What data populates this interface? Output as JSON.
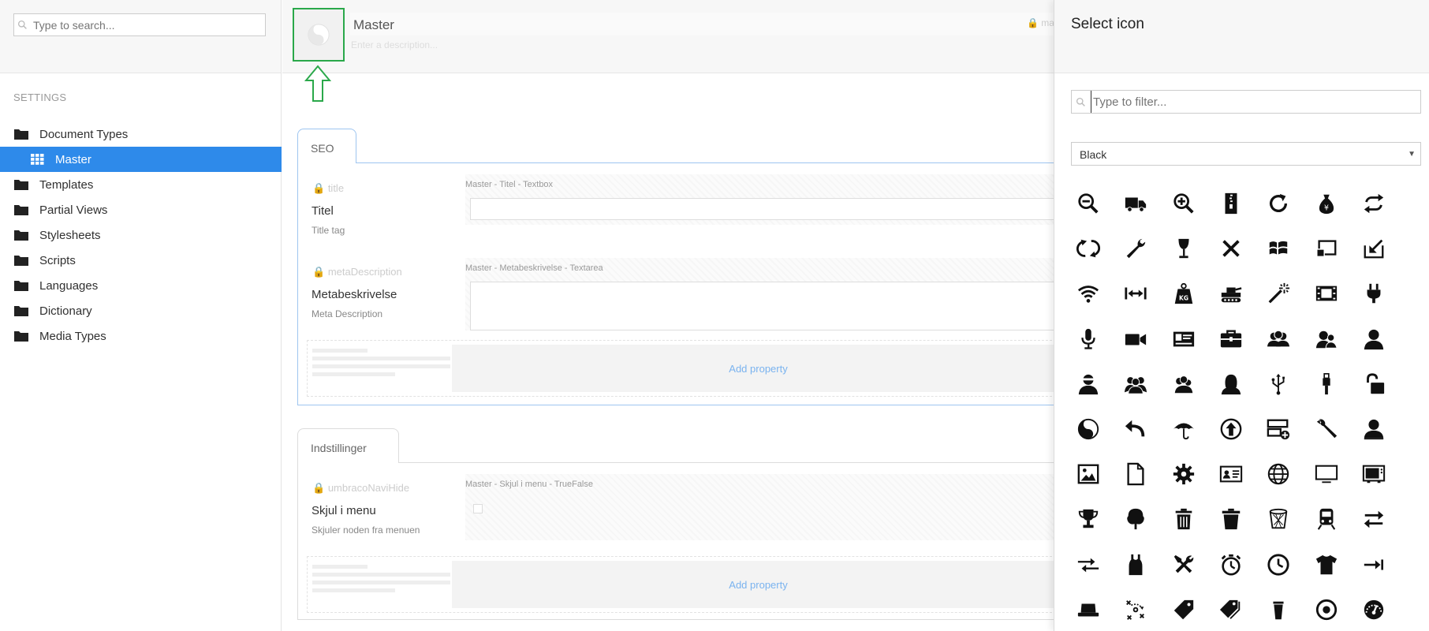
{
  "sidebar": {
    "search_placeholder": "Type to search...",
    "section_heading": "SETTINGS",
    "items": [
      {
        "label": "Document Types",
        "active": false,
        "icon": "folder-icon"
      },
      {
        "label": "Master",
        "active": true,
        "icon": "grid-icon"
      },
      {
        "label": "Templates",
        "active": false,
        "icon": "folder-icon"
      },
      {
        "label": "Partial Views",
        "active": false,
        "icon": "folder-icon"
      },
      {
        "label": "Stylesheets",
        "active": false,
        "icon": "folder-icon"
      },
      {
        "label": "Scripts",
        "active": false,
        "icon": "folder-icon"
      },
      {
        "label": "Languages",
        "active": false,
        "icon": "folder-icon"
      },
      {
        "label": "Dictionary",
        "active": false,
        "icon": "folder-icon"
      },
      {
        "label": "Media Types",
        "active": false,
        "icon": "folder-icon"
      }
    ]
  },
  "editor": {
    "name": "Master",
    "alias_prefix": "ma",
    "description_placeholder": "Enter a description...",
    "groups": [
      {
        "tab": "SEO",
        "properties": [
          {
            "alias": "title",
            "label": "Titel",
            "description": "Title tag",
            "meta": "Master - Titel - Textbox"
          },
          {
            "alias": "metaDescription",
            "label": "Metabeskrivelse",
            "description": "Meta Description",
            "meta": "Master - Metabeskrivelse - Textarea"
          }
        ],
        "add_property": "Add property"
      },
      {
        "tab": "Indstillinger",
        "properties": [
          {
            "alias": "umbracoNaviHide",
            "label": "Skjul i menu",
            "description": "Skjuler noden fra menuen",
            "meta": "Master - Skjul i menu - TrueFalse"
          }
        ],
        "add_property": "Add property"
      }
    ]
  },
  "panel": {
    "title": "Select icon",
    "filter_placeholder": "Type to filter...",
    "color_selected": "Black",
    "icons": [
      "zoom-out-icon",
      "truck-icon",
      "zoom-in-icon",
      "zip-icon",
      "refresh-icon",
      "yen-bag-icon",
      "sync-icon",
      "sync-vertical-icon",
      "wrench-icon",
      "wine-glass-icon",
      "close-icon",
      "windows-icon",
      "cast-icon",
      "download-corner-icon",
      "wifi-icon",
      "width-icon",
      "weight-icon",
      "tank-icon",
      "magic-wand-icon",
      "film-icon",
      "plug-icon",
      "microphone-icon",
      "video-icon",
      "id-card-icon",
      "toolbox-icon",
      "users-icon",
      "users-alt-icon",
      "user-icon",
      "user-glasses-icon",
      "user-group-icon",
      "users-three-icon",
      "user-female-icon",
      "usb-icon",
      "usb-plug-icon",
      "unlock-icon",
      "yin-yang-icon",
      "undo-icon",
      "umbrella-icon",
      "upload-circle-icon",
      "server-add-icon",
      "tool-icon",
      "user-badge-icon",
      "picture-icon",
      "document-icon",
      "gear-icon",
      "address-card-icon",
      "globe-icon",
      "monitor-icon",
      "tv-icon",
      "trophy-icon",
      "tree-icon",
      "trash-icon",
      "trash-alt-icon",
      "bin-icon",
      "train-icon",
      "transfer-icon",
      "exchange-icon",
      "tank-top-icon",
      "tools-icon",
      "stopwatch-icon",
      "clock-icon",
      "tshirt-icon",
      "tab-key-icon",
      "hat-icon",
      "tactics-icon",
      "tag-icon",
      "tags-icon",
      "cup-icon",
      "target-icon",
      "speedometer-icon"
    ],
    "colors": {
      "icon": "#111111"
    }
  },
  "colors": {
    "accent": "#2e8aea",
    "highlight_box": "#2aa84a",
    "add_property_link": "#7ab3ef"
  }
}
